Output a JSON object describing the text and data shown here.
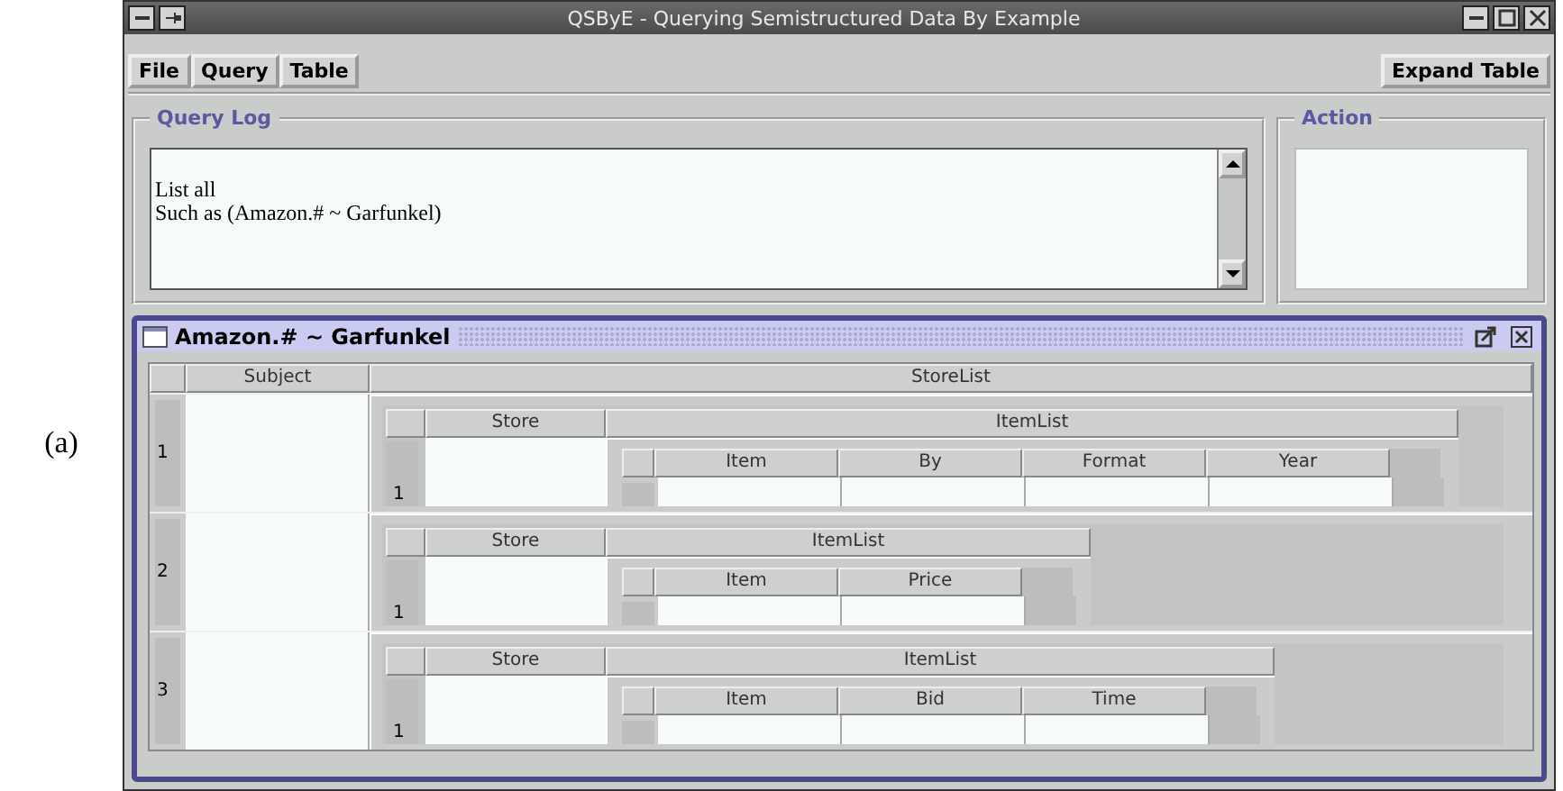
{
  "figure_label": "(a)",
  "window": {
    "title": "QSByE - Querying Semistructured Data By Example"
  },
  "menu": [
    "File",
    "Query",
    "Table"
  ],
  "expand_button": "Expand Table",
  "query_log": {
    "title": "Query Log",
    "lines": [
      "List all",
      "Such as (Amazon.# ~ Garfunkel)"
    ]
  },
  "action": {
    "title": "Action"
  },
  "frame": {
    "title": "Amazon.# ~ Garfunkel"
  },
  "table": {
    "columns": [
      "Subject",
      "StoreList"
    ],
    "rows": [
      {
        "number": "1",
        "stores": {
          "columns": [
            "Store",
            "ItemList"
          ],
          "rows": [
            {
              "number": "1",
              "items": {
                "columns": [
                  "Item",
                  "By",
                  "Format",
                  "Year"
                ]
              }
            }
          ]
        }
      },
      {
        "number": "2",
        "stores": {
          "columns": [
            "Store",
            "ItemList"
          ],
          "rows": [
            {
              "number": "1",
              "items": {
                "columns": [
                  "Item",
                  "Price"
                ]
              }
            }
          ]
        }
      },
      {
        "number": "3",
        "stores": {
          "columns": [
            "Store",
            "ItemList"
          ],
          "rows": [
            {
              "number": "1",
              "items": {
                "columns": [
                  "Item",
                  "Bid",
                  "Time"
                ]
              }
            }
          ]
        }
      }
    ]
  }
}
